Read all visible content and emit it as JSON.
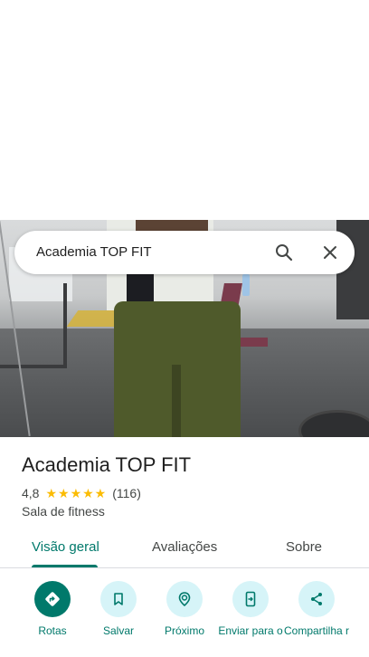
{
  "search": {
    "query": "Academia TOP FIT"
  },
  "place": {
    "title": "Academia TOP FIT",
    "rating": "4,8",
    "stars": "★★★★★",
    "review_count": "(116)",
    "category": "Sala de fitness"
  },
  "tabs": [
    {
      "label": "Visão geral",
      "active": true
    },
    {
      "label": "Avaliações",
      "active": false
    },
    {
      "label": "Sobre",
      "active": false
    }
  ],
  "actions": [
    {
      "label": "Rotas",
      "icon": "directions-icon"
    },
    {
      "label": "Salvar",
      "icon": "bookmark-icon"
    },
    {
      "label": "Próximo",
      "icon": "nearby-icon"
    },
    {
      "label": "Enviar para o",
      "icon": "send-to-phone-icon"
    },
    {
      "label": "Compartilha r",
      "icon": "share-icon"
    }
  ],
  "colors": {
    "accent": "#00796b",
    "action_bg": "#d6f4f8",
    "stars": "#fbbc04"
  }
}
